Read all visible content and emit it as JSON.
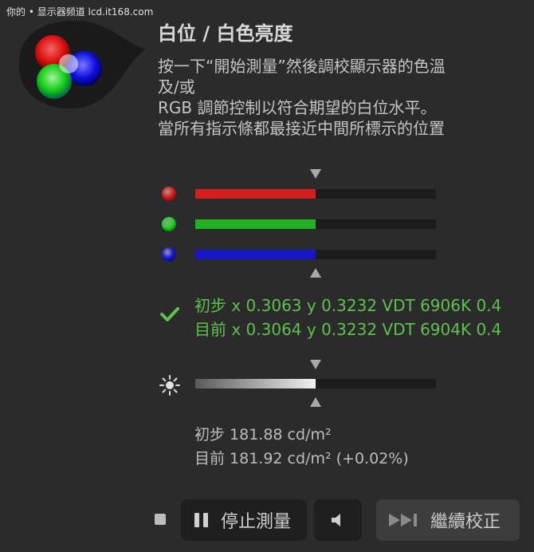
{
  "watermark": "你的 • 显示器频道 lcd.it168.com",
  "title": "白位 / 白色亮度",
  "instructions": [
    "按一下“開始測量”然後調校顯示器的色溫",
    "及/或",
    "RGB 調節控制以符合期望的白位水平。",
    "當所有指示條都最接近中間所標示的位置"
  ],
  "rgb_bars": [
    {
      "name": "red",
      "color": "#d41e1e",
      "dot_color": "#e01818",
      "level": 0.5
    },
    {
      "name": "green",
      "color": "#22b022",
      "dot_color": "#1fd41f",
      "level": 0.5
    },
    {
      "name": "blue",
      "color": "#1616c8",
      "dot_color": "#1616d8",
      "level": 0.5
    }
  ],
  "readings": {
    "initial": "初步 x 0.3063 y 0.3232 VDT 6906K 0.4",
    "current": "目前 x 0.3064 y 0.3232 VDT 6904K 0.4"
  },
  "luminance": {
    "level": 0.5,
    "initial": "初步 181.88 cd/m²",
    "current": "目前 181.92 cd/m² (+0.02%)"
  },
  "buttons": {
    "stop_label": "停止測量",
    "continue_label": "繼續校正"
  },
  "colors": {
    "accent_green": "#5cc24c",
    "background": "#2b2b2b"
  },
  "icons": [
    "rgb-logo-icon",
    "check-icon",
    "sun-icon",
    "pause-icon",
    "speaker-icon",
    "skip-forward-icon",
    "stop-icon"
  ]
}
